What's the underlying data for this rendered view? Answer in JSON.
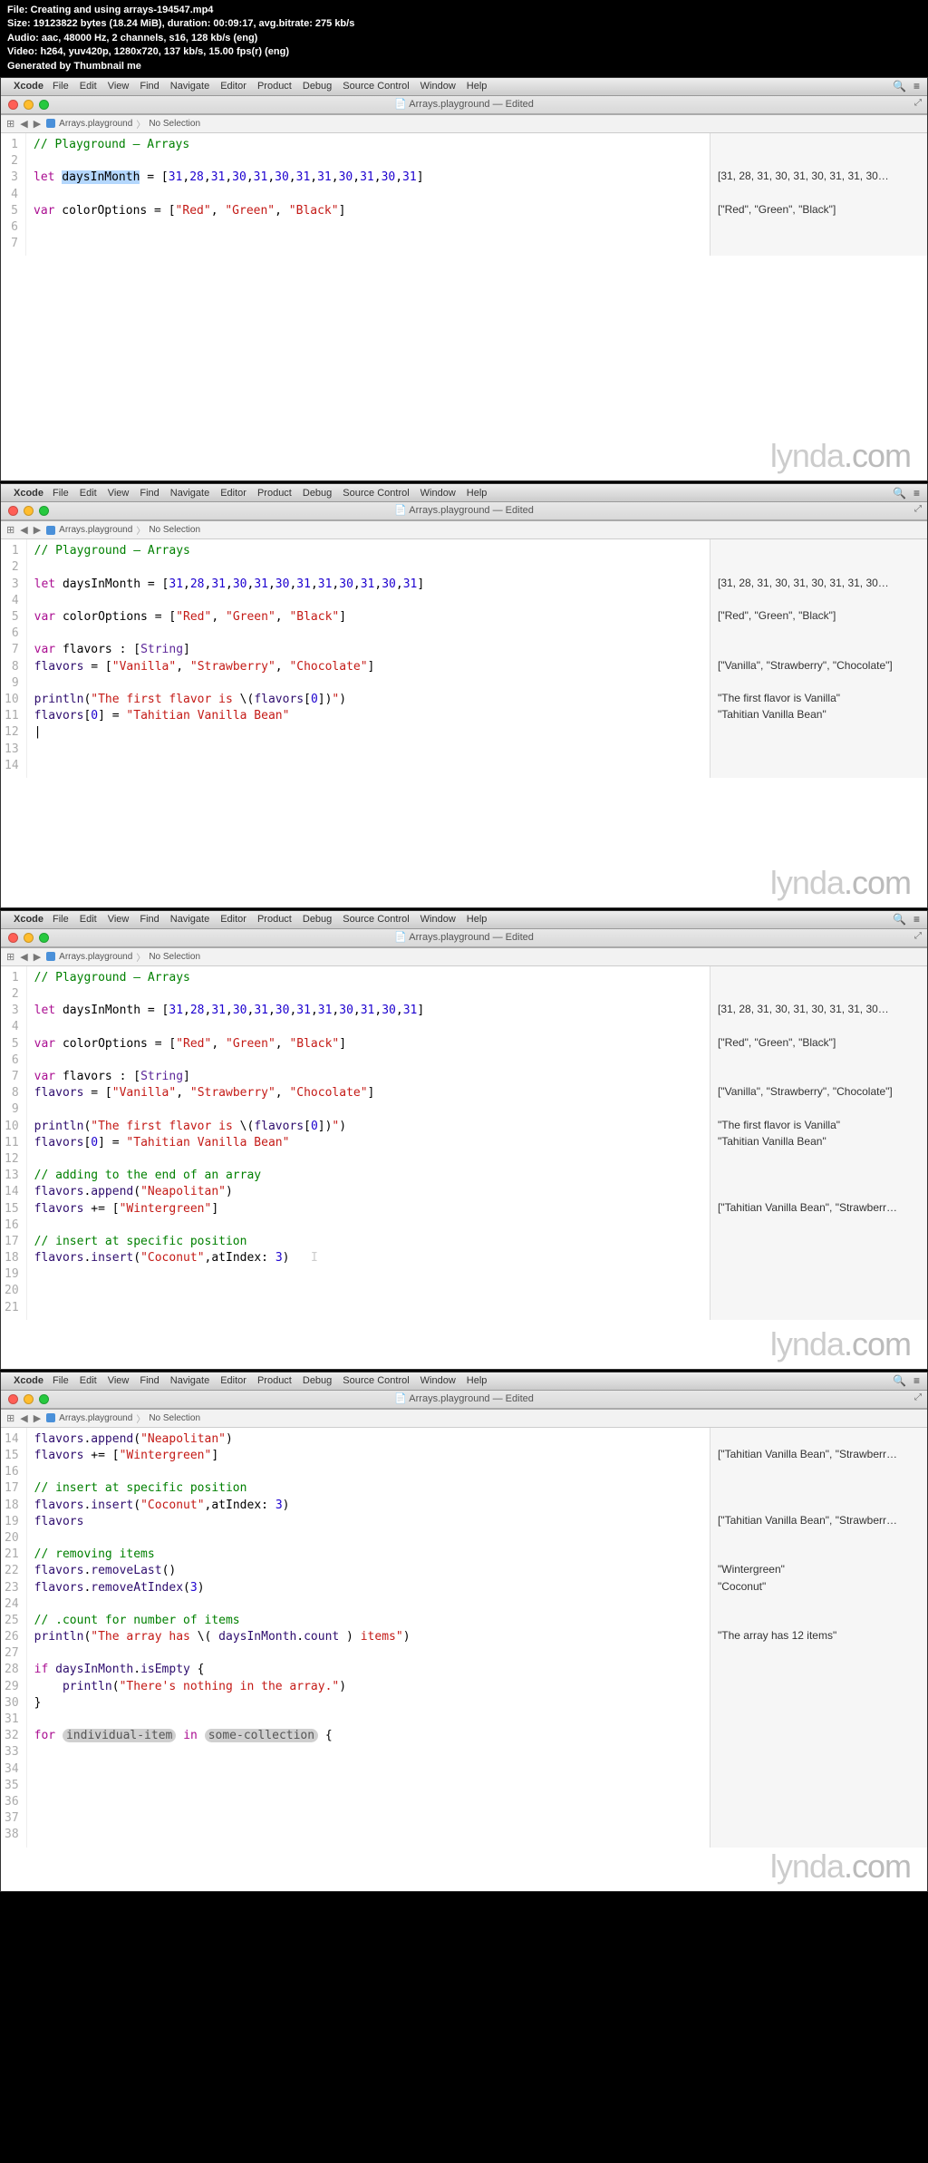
{
  "header": {
    "file": "File: Creating and using arrays-194547.mp4",
    "size": "Size: 19123822 bytes (18.24 MiB), duration: 00:09:17, avg.bitrate: 275 kb/s",
    "audio": "Audio: aac, 48000 Hz, 2 channels, s16, 128 kb/s (eng)",
    "video": "Video: h264, yuv420p, 1280x720, 137 kb/s, 15.00 fps(r) (eng)",
    "generated": "Generated by Thumbnail me"
  },
  "menubar": {
    "app": "Xcode",
    "items": [
      "File",
      "Edit",
      "View",
      "Find",
      "Navigate",
      "Editor",
      "Product",
      "Debug",
      "Source Control",
      "Window",
      "Help"
    ]
  },
  "window": {
    "title": "Arrays.playground — Edited"
  },
  "breadcrumb": {
    "file": "Arrays.playground",
    "selection": "No Selection"
  },
  "watermark": {
    "a": "lynda",
    "b": ".com"
  },
  "frame1": {
    "lines": [
      {
        "n": "1",
        "html": "<span class='cm'>// Playground – Arrays</span>",
        "r": ""
      },
      {
        "n": "2",
        "html": "",
        "r": ""
      },
      {
        "n": "3",
        "html": "<span class='kw'>let</span> <span class='sel'>daysInMonth</span> = [<span class='nm'>31</span>,<span class='nm'>28</span>,<span class='nm'>31</span>,<span class='nm'>30</span>,<span class='nm'>31</span>,<span class='nm'>30</span>,<span class='nm'>31</span>,<span class='nm'>31</span>,<span class='nm'>30</span>,<span class='nm'>31</span>,<span class='nm'>30</span>,<span class='nm'>31</span>]",
        "r": "[31, 28, 31, 30, 31, 30, 31, 31, 30…"
      },
      {
        "n": "4",
        "html": "",
        "r": ""
      },
      {
        "n": "5",
        "html": "<span class='kw'>var</span> colorOptions = [<span class='st'>\"Red\"</span>, <span class='st'>\"Green\"</span>, <span class='st'>\"Black\"</span>]",
        "r": "[\"Red\", \"Green\", \"Black\"]"
      },
      {
        "n": "6",
        "html": "",
        "r": ""
      },
      {
        "n": "7",
        "html": "",
        "r": ""
      }
    ],
    "filler": 200
  },
  "frame2": {
    "lines": [
      {
        "n": "1",
        "html": "<span class='cm'>// Playground – Arrays</span>",
        "r": ""
      },
      {
        "n": "2",
        "html": "",
        "r": ""
      },
      {
        "n": "3",
        "html": "<span class='kw'>let</span> daysInMonth = [<span class='nm'>31</span>,<span class='nm'>28</span>,<span class='nm'>31</span>,<span class='nm'>30</span>,<span class='nm'>31</span>,<span class='nm'>30</span>,<span class='nm'>31</span>,<span class='nm'>31</span>,<span class='nm'>30</span>,<span class='nm'>31</span>,<span class='nm'>30</span>,<span class='nm'>31</span>]",
        "r": "[31, 28, 31, 30, 31, 30, 31, 31, 30…"
      },
      {
        "n": "4",
        "html": "",
        "r": ""
      },
      {
        "n": "5",
        "html": "<span class='kw'>var</span> colorOptions = [<span class='st'>\"Red\"</span>, <span class='st'>\"Green\"</span>, <span class='st'>\"Black\"</span>]",
        "r": "[\"Red\", \"Green\", \"Black\"]"
      },
      {
        "n": "6",
        "html": "",
        "r": ""
      },
      {
        "n": "7",
        "html": "<span class='kw'>var</span> flavors : [<span class='ty'>String</span>]",
        "r": ""
      },
      {
        "n": "8",
        "html": "<span class='fn'>flavors</span> = [<span class='st'>\"Vanilla\"</span>, <span class='st'>\"Strawberry\"</span>, <span class='st'>\"Chocolate\"</span>]",
        "r": "[\"Vanilla\", \"Strawberry\", \"Chocolate\"]"
      },
      {
        "n": "9",
        "html": "",
        "r": ""
      },
      {
        "n": "10",
        "html": "<span class='fn'>println</span>(<span class='st'>\"The first flavor is </span>\\(<span class='fn'>flavors</span>[<span class='nm'>0</span>])<span class='st'>\"</span>)",
        "r": "\"The first flavor is Vanilla\""
      },
      {
        "n": "11",
        "html": "<span class='fn'>flavors</span>[<span class='nm'>0</span>] = <span class='st'>\"Tahitian Vanilla Bean\"</span>",
        "r": "\"Tahitian Vanilla Bean\""
      },
      {
        "n": "12",
        "html": "|",
        "r": ""
      },
      {
        "n": "13",
        "html": "",
        "r": ""
      },
      {
        "n": "14",
        "html": "",
        "r": ""
      }
    ],
    "filler": 95
  },
  "frame3": {
    "lines": [
      {
        "n": "1",
        "html": "<span class='cm'>// Playground – Arrays</span>",
        "r": ""
      },
      {
        "n": "2",
        "html": "",
        "r": ""
      },
      {
        "n": "3",
        "html": "<span class='kw'>let</span> daysInMonth = [<span class='nm'>31</span>,<span class='nm'>28</span>,<span class='nm'>31</span>,<span class='nm'>30</span>,<span class='nm'>31</span>,<span class='nm'>30</span>,<span class='nm'>31</span>,<span class='nm'>31</span>,<span class='nm'>30</span>,<span class='nm'>31</span>,<span class='nm'>30</span>,<span class='nm'>31</span>]",
        "r": "[31, 28, 31, 30, 31, 30, 31, 31, 30…"
      },
      {
        "n": "4",
        "html": "",
        "r": ""
      },
      {
        "n": "5",
        "html": "<span class='kw'>var</span> colorOptions = [<span class='st'>\"Red\"</span>, <span class='st'>\"Green\"</span>, <span class='st'>\"Black\"</span>]",
        "r": "[\"Red\", \"Green\", \"Black\"]"
      },
      {
        "n": "6",
        "html": "",
        "r": ""
      },
      {
        "n": "7",
        "html": "<span class='kw'>var</span> flavors : [<span class='ty'>String</span>]",
        "r": ""
      },
      {
        "n": "8",
        "html": "<span class='fn'>flavors</span> = [<span class='st'>\"Vanilla\"</span>, <span class='st'>\"Strawberry\"</span>, <span class='st'>\"Chocolate\"</span>]",
        "r": "[\"Vanilla\", \"Strawberry\", \"Chocolate\"]"
      },
      {
        "n": "9",
        "html": "",
        "r": ""
      },
      {
        "n": "10",
        "html": "<span class='fn'>println</span>(<span class='st'>\"The first flavor is </span>\\(<span class='fn'>flavors</span>[<span class='nm'>0</span>])<span class='st'>\"</span>)",
        "r": "\"The first flavor is Vanilla\""
      },
      {
        "n": "11",
        "html": "<span class='fn'>flavors</span>[<span class='nm'>0</span>] = <span class='st'>\"Tahitian Vanilla Bean\"</span>",
        "r": "\"Tahitian Vanilla Bean\""
      },
      {
        "n": "12",
        "html": "",
        "r": ""
      },
      {
        "n": "13",
        "html": "<span class='cm'>// adding to the end of an array</span>",
        "r": ""
      },
      {
        "n": "14",
        "html": "<span class='fn'>flavors</span>.<span class='fn'>append</span>(<span class='st'>\"Neapolitan\"</span>)",
        "r": ""
      },
      {
        "n": "15",
        "html": "<span class='fn'>flavors</span> += [<span class='st'>\"Wintergreen\"</span>]",
        "r": "[\"Tahitian Vanilla Bean\", \"Strawberr…"
      },
      {
        "n": "16",
        "html": "",
        "r": ""
      },
      {
        "n": "17",
        "html": "<span class='cm'>// insert at specific position</span>",
        "r": ""
      },
      {
        "n": "18",
        "html": "<span class='fn'>flavors</span>.<span class='fn'>insert</span>(<span class='st'>\"Coconut\"</span>,atIndex: <span class='nm'>3</span>)   <span style='color:#ccc'>I</span>",
        "r": ""
      },
      {
        "n": "19",
        "html": "",
        "r": ""
      },
      {
        "n": "20",
        "html": "",
        "r": ""
      },
      {
        "n": "21",
        "html": "",
        "r": ""
      }
    ],
    "filler": 6
  },
  "frame4": {
    "lines": [
      {
        "n": "14",
        "html": "<span class='fn'>flavors</span>.<span class='fn'>append</span>(<span class='st'>\"Neapolitan\"</span>)",
        "r": ""
      },
      {
        "n": "15",
        "html": "<span class='fn'>flavors</span> += [<span class='st'>\"Wintergreen\"</span>]",
        "r": "[\"Tahitian Vanilla Bean\", \"Strawberr…"
      },
      {
        "n": "16",
        "html": "",
        "r": ""
      },
      {
        "n": "17",
        "html": "<span class='cm'>// insert at specific position</span>",
        "r": ""
      },
      {
        "n": "18",
        "html": "<span class='fn'>flavors</span>.<span class='fn'>insert</span>(<span class='st'>\"Coconut\"</span>,atIndex: <span class='nm'>3</span>)",
        "r": ""
      },
      {
        "n": "19",
        "html": "<span class='fn'>flavors</span>",
        "r": "[\"Tahitian Vanilla Bean\", \"Strawberr…"
      },
      {
        "n": "20",
        "html": "",
        "r": ""
      },
      {
        "n": "21",
        "html": "<span class='cm'>// removing items</span>",
        "r": ""
      },
      {
        "n": "22",
        "html": "<span class='fn'>flavors</span>.<span class='fn'>removeLast</span>()",
        "r": "\"Wintergreen\""
      },
      {
        "n": "23",
        "html": "<span class='fn'>flavors</span>.<span class='fn'>removeAtIndex</span>(<span class='nm'>3</span>)",
        "r": "\"Coconut\""
      },
      {
        "n": "24",
        "html": "",
        "r": ""
      },
      {
        "n": "25",
        "html": "<span class='cm'>// .count for number of items</span>",
        "r": ""
      },
      {
        "n": "26",
        "html": "<span class='fn'>println</span>(<span class='st'>\"The array has </span>\\( <span class='fn'>daysInMonth</span>.<span class='fn'>count</span> )<span class='st'> items\"</span>)",
        "r": "\"The array has 12 items\""
      },
      {
        "n": "27",
        "html": "",
        "r": ""
      },
      {
        "n": "28",
        "html": "<span class='kw'>if</span> <span class='fn'>daysInMonth</span>.<span class='fn'>isEmpty</span> {",
        "r": ""
      },
      {
        "n": "29",
        "html": "    <span class='fn'>println</span>(<span class='st'>\"There's nothing in the array.\"</span>)",
        "r": ""
      },
      {
        "n": "30",
        "html": "}",
        "r": ""
      },
      {
        "n": "31",
        "html": "",
        "r": ""
      },
      {
        "n": "32",
        "err": true,
        "html": "<span class='kw'>for</span> <span class='plh'>individual-item</span> <span class='kw'>in</span> <span class='plh'>some-collection</span> {",
        "r": ""
      },
      {
        "n": "33",
        "html": "",
        "r": ""
      },
      {
        "n": "34",
        "html": "",
        "r": ""
      },
      {
        "n": "35",
        "html": "",
        "r": ""
      },
      {
        "n": "36",
        "html": "",
        "r": ""
      },
      {
        "n": "37",
        "html": "",
        "r": ""
      },
      {
        "n": "38",
        "html": "",
        "r": ""
      }
    ],
    "filler": 0
  }
}
